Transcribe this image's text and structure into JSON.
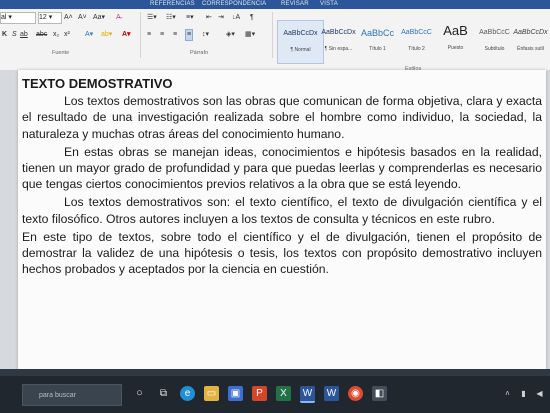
{
  "ribbon": {
    "tabs": [
      "REFERENCIAS",
      "CORRESPONDENCIA",
      "REVISAR",
      "VISTA"
    ],
    "font_name": "al",
    "font_size": "12",
    "groups": [
      "Fuente",
      "Párrafo",
      "Estilos"
    ],
    "styles": [
      {
        "sample": "AaBbCcDx",
        "name": "¶ Normal"
      },
      {
        "sample": "AaBbCcDx",
        "name": "¶ Sin espa..."
      },
      {
        "sample": "AaBbCc",
        "name": "Título 1"
      },
      {
        "sample": "AaBbCcC",
        "name": "Título 2"
      },
      {
        "sample": "AaB",
        "name": "Puesto"
      },
      {
        "sample": "AaBbCcC",
        "name": "Subtítulo"
      },
      {
        "sample": "AaBbCcDx",
        "name": "Énfasis sutil"
      }
    ]
  },
  "document": {
    "title": "TEXTO DEMOSTRATIVO",
    "paragraphs": [
      "Los textos demostrativos son las obras que comunican de forma objetiva, clara y exacta el resultado de una investigación realizada sobre el hombre como individuo, la sociedad, la naturaleza y muchas otras áreas del conocimiento humano.",
      "En estas obras se manejan ideas, conocimientos e hipótesis basados en la realidad, tienen un mayor grado de profundidad y para que puedas leerlas y comprenderlas es necesario que tengas ciertos conocimientos previos relativos a la obra que se está leyendo.",
      "Los textos demostrativos son: el texto científico, el texto de divulgación científica y el texto filosófico. Otros autores incluyen a los textos de consulta y técnicos en este rubro.",
      "En este tipo de textos, sobre todo el científico y el de divulgación, tienen el propósito de demostrar la validez de una hipótesis o tesis, los textos con propósito demostrativo incluyen hechos probados y aceptados por la ciencia en cuestión."
    ]
  },
  "taskbar": {
    "search_placeholder": "para buscar"
  },
  "colors": {
    "menubar": "#2b579a",
    "taskbar": "#20272f"
  }
}
